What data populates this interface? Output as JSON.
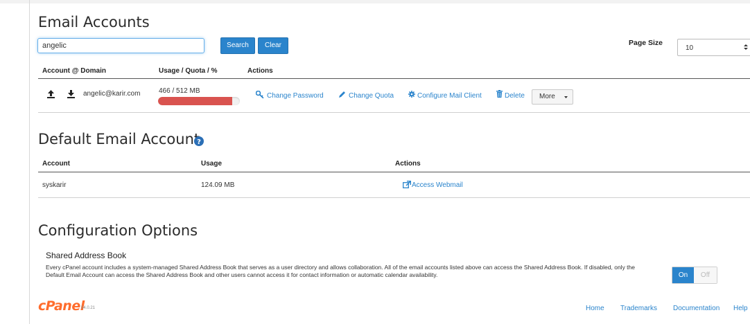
{
  "email_accounts": {
    "title": "Email Accounts",
    "search": {
      "value": "angelic",
      "search_label": "Search",
      "clear_label": "Clear"
    },
    "page_size": {
      "label": "Page Size",
      "selected": "10"
    },
    "columns": [
      "Account @ Domain",
      "Usage / Quota / %",
      "Actions"
    ],
    "rows": [
      {
        "account": "angelic@karir.com",
        "usage_quota": "466 / 512 MB",
        "usage_fraction": 0.91,
        "actions": {
          "change_password": "Change Password",
          "change_quota": "Change Quota",
          "configure_mail_client": "Configure Mail Client",
          "delete": "Delete",
          "more": "More"
        }
      }
    ]
  },
  "default_account": {
    "title": "Default Email Account",
    "columns": [
      "Account",
      "Usage",
      "Actions"
    ],
    "row": {
      "account": "syskarir",
      "usage": "124.09 MB",
      "action": "Access Webmail"
    }
  },
  "configuration": {
    "title": "Configuration Options",
    "shared_address_book": {
      "heading": "Shared Address Book",
      "description": "Every cPanel account includes a system-managed Shared Address Book that serves as a user directory and allows collaboration. All of the email accounts listed above can access the Shared Address Book. If disabled, only the Default Email Account can access the Shared Address Book and other users cannot access it for contact information or automatic calendar availability.",
      "toggle": {
        "on_label": "On",
        "off_label": "Off",
        "state": "On"
      }
    }
  },
  "footer": {
    "logo": "cPanel",
    "version": "54.0.21",
    "links": [
      "Home",
      "Trademarks",
      "Documentation",
      "Help"
    ]
  },
  "colors": {
    "accent": "#2a84cc",
    "quota_bar": "#d9534f",
    "logo": "#ff6c2c"
  }
}
